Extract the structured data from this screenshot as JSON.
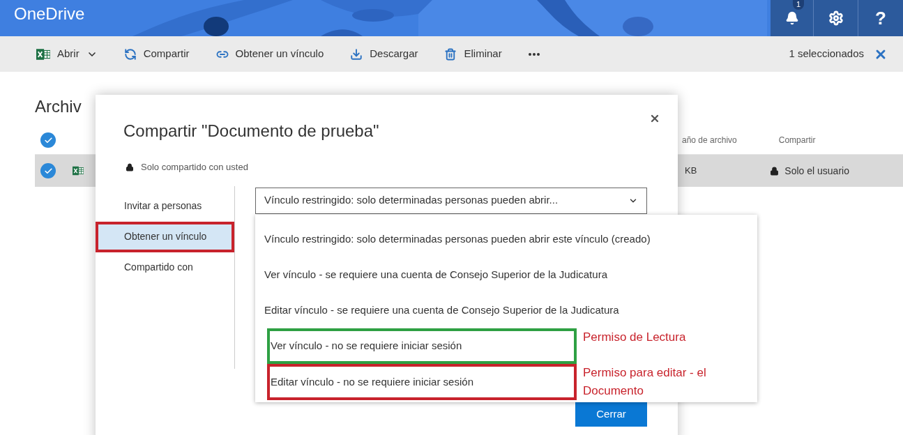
{
  "header": {
    "title": "OneDrive",
    "notifications": "1",
    "help": "?"
  },
  "toolbar": {
    "items": [
      {
        "kind": "excel",
        "label": "Abrir",
        "dropdown": true
      },
      {
        "kind": "share",
        "label": "Compartir",
        "dropdown": false
      },
      {
        "kind": "link",
        "label": "Obtener un vínculo",
        "dropdown": false
      },
      {
        "kind": "download",
        "label": "Descargar",
        "dropdown": false
      },
      {
        "kind": "delete",
        "label": "Eliminar",
        "dropdown": false
      },
      {
        "kind": "more",
        "dropdown": false
      }
    ],
    "selection": "1 seleccionados"
  },
  "files": {
    "heading": "Archiv",
    "columns": [
      "año de archivo",
      "Compartir"
    ],
    "rows": [
      {
        "selected": true,
        "size": "KB",
        "sharing": "Solo el usuario"
      }
    ]
  },
  "dialog": {
    "title": "Compartir \"Documento de prueba\"",
    "status": "Solo compartido con usted",
    "nav": [
      {
        "label": "Invitar a personas",
        "selected": false
      },
      {
        "label": "Obtener un vínculo",
        "selected": true,
        "color": "#c8232c"
      },
      {
        "label": "Compartido con",
        "selected": false
      }
    ],
    "select": {
      "value": "Vínculo restringido: solo determinadas personas pueden abrir...",
      "expanded": true
    },
    "options": [
      {
        "label": "Vínculo restringido: solo determinadas personas pueden abrir este vínculo (creado)"
      },
      {
        "label": "Ver vínculo - se requiere una cuenta de Consejo Superior de la Judicatura"
      },
      {
        "label": "Editar vínculo - se requiere una cuenta de Consejo Superior de la Judicatura"
      },
      {
        "label": "Ver vínculo - no se requiere iniciar sesión",
        "color": "#2ea043",
        "note": "Permiso de Lectura"
      },
      {
        "label": "Editar vínculo - no se requiere iniciar sesión",
        "color": "#c8232c",
        "note": "Permiso para editar - el Documento"
      }
    ],
    "buttons": [
      "Cerrar"
    ]
  }
}
